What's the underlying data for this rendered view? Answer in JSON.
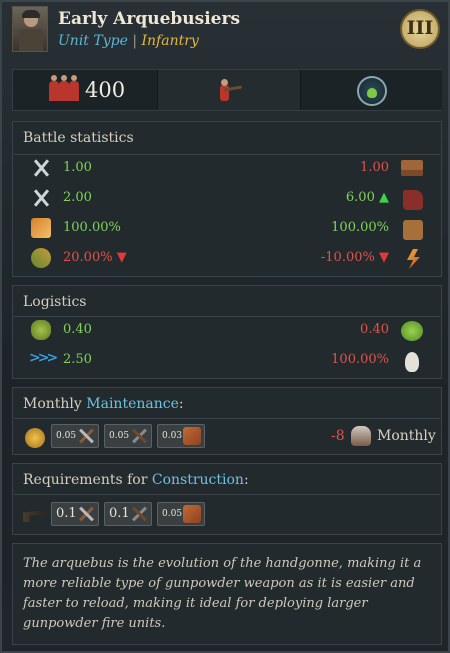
{
  "header": {
    "title": "Early Arquebusiers",
    "unit_type_label": "Unit Type",
    "separator": "|",
    "unit_class": "Infantry",
    "tier": "III"
  },
  "tabs": {
    "soldier_count": "400",
    "icons": [
      "men-icon",
      "arquebusier-icon",
      "potion-icon"
    ]
  },
  "battle": {
    "title": "Battle statistics",
    "rows": [
      {
        "left_icon": "melee-attack-icon",
        "left": "1.00",
        "right": "1.00",
        "right_icon": "armor-icon",
        "left_color": "green",
        "right_color": "red",
        "right_arrow": ""
      },
      {
        "left_icon": "charge-attack-icon",
        "left": "2.00",
        "right": "6.00",
        "right_icon": "speed-icon",
        "left_color": "green",
        "right_color": "green",
        "right_arrow": "up"
      },
      {
        "left_icon": "flank-icon",
        "left": "100.00%",
        "right": "100.00%",
        "right_icon": "defense-lock-icon",
        "left_color": "green",
        "right_color": "green",
        "right_arrow": ""
      },
      {
        "left_icon": "ranged-icon",
        "left": "20.00%",
        "left_arrow": "down",
        "right": "-10.00%",
        "right_icon": "bolt-icon",
        "left_color": "red",
        "right_color": "red",
        "right_arrow": "down"
      }
    ]
  },
  "logistics": {
    "title": "Logistics",
    "rows": [
      {
        "left_icon": "supplies-icon",
        "left": "0.40",
        "right": "0.40",
        "right_icon": "food-icon",
        "left_color": "green",
        "right_color": "red"
      },
      {
        "left_icon": "march-icon",
        "left": "2.50",
        "right": "100.00%",
        "right_icon": "skull-icon",
        "left_color": "green",
        "right_color": "red"
      }
    ]
  },
  "maintenance": {
    "title_prefix": "Monthly",
    "title_link": "Maintenance",
    "title_suffix": ":",
    "costs": [
      {
        "value": "0.05",
        "icon": "lumber-icon"
      },
      {
        "value": "0.05",
        "icon": "iron-icon"
      },
      {
        "value": "0.03",
        "icon": "leather-icon"
      }
    ],
    "soldiers": "-8",
    "period": "Monthly"
  },
  "construction": {
    "title_prefix": "Requirements for",
    "title_link": "Construction",
    "title_suffix": ":",
    "costs": [
      {
        "value": "0.1",
        "icon": "lumber-icon"
      },
      {
        "value": "0.1",
        "icon": "iron-icon"
      },
      {
        "value": "0.05",
        "icon": "leather-icon"
      }
    ]
  },
  "description": "The arquebus is the evolution of the handgonne, making it a more reliable type of gunpowder weapon as it is easier and faster to reload, making it ideal for deploying larger gunpowder fire units."
}
